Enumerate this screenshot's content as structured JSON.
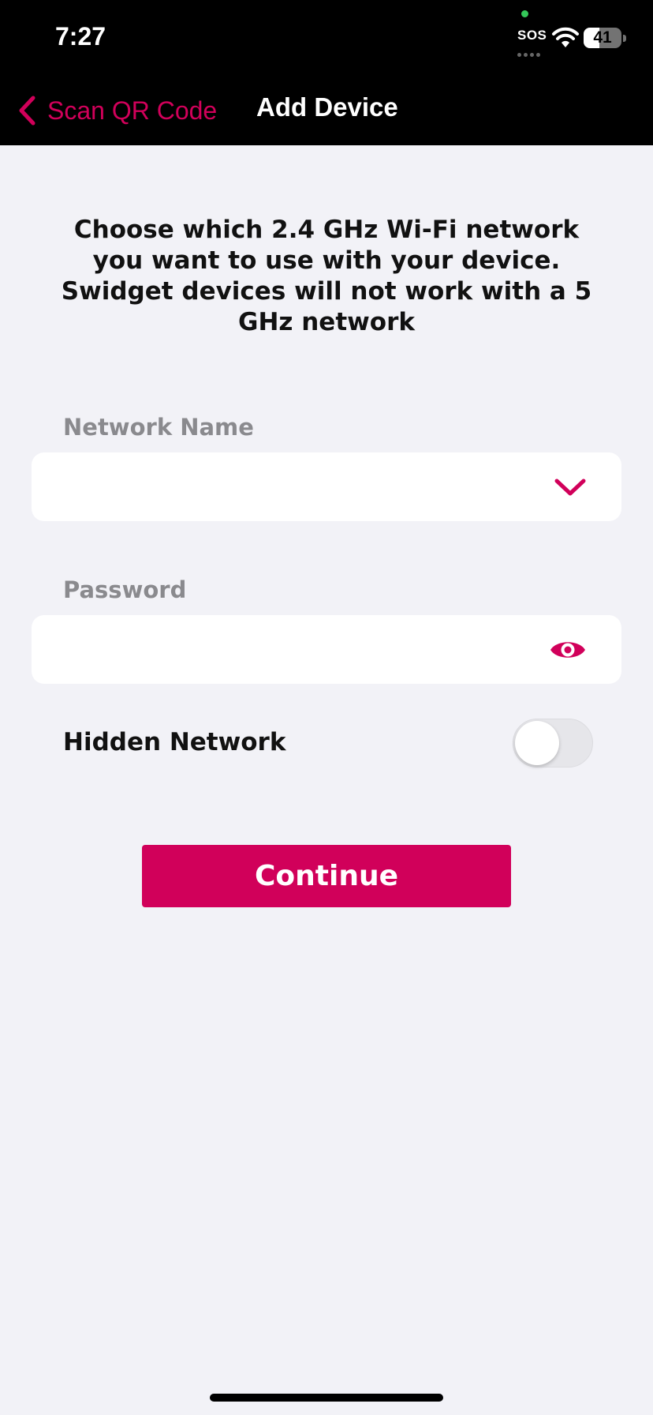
{
  "status_bar": {
    "time": "7:27",
    "carrier_text": "SOS",
    "battery_level": "41",
    "battery_fraction": 0.41,
    "icons": [
      "wifi-icon",
      "battery-icon"
    ]
  },
  "nav": {
    "back_label": "Scan QR Code",
    "title": "Add Device"
  },
  "instructions": "Choose which 2.4 GHz Wi-Fi network you want to use with your device. Swidget devices will not work with a 5 GHz network",
  "form": {
    "network_name": {
      "label": "Network Name",
      "value": "",
      "icon": "chevron-down-icon"
    },
    "password": {
      "label": "Password",
      "value": "",
      "icon": "eye-icon"
    },
    "hidden_network": {
      "label": "Hidden Network",
      "enabled": false
    }
  },
  "continue_label": "Continue",
  "colors": {
    "accent": "#d1005a",
    "background": "#f2f2f7",
    "header": "#000000",
    "label_gray": "#8a8a8e"
  }
}
